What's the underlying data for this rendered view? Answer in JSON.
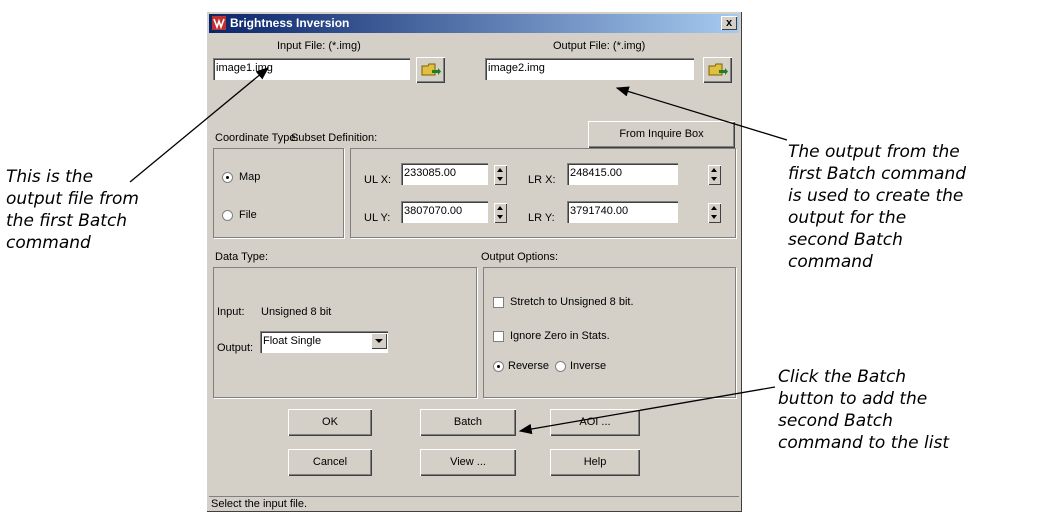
{
  "dialog": {
    "title": "Brightness Inversion",
    "close_label": "x",
    "input_file_label": "Input File: (*.img)",
    "input_file_value": "image1.img",
    "output_file_label": "Output File: (*.img)",
    "output_file_value": "image2.img",
    "coordinate_type_label": "Coordinate Type:",
    "subset_definition_label": "Subset Definition:",
    "from_inquire_box_label": "From Inquire Box",
    "map_label": "Map",
    "file_label": "File",
    "ulx_label": "UL X:",
    "ulx_value": "233085.00",
    "uly_label": "UL Y:",
    "uly_value": "3807070.00",
    "lrx_label": "LR X:",
    "lrx_value": "248415.00",
    "lry_label": "LR Y:",
    "lry_value": "3791740.00",
    "data_type_label": "Data Type:",
    "input_label": "Input:",
    "input_type_value": "Unsigned 8 bit",
    "output_label": "Output:",
    "output_type_value": "Float Single",
    "output_options_label": "Output Options:",
    "stretch_label": "Stretch to Unsigned 8 bit.",
    "ignore_zero_label": "Ignore Zero in Stats.",
    "reverse_label": "Reverse",
    "inverse_label": "Inverse",
    "ok_label": "OK",
    "batch_label": "Batch",
    "aoi_label": "AOI ...",
    "cancel_label": "Cancel",
    "view_label": "View ...",
    "help_label": "Help",
    "status_text": "Select the input file."
  },
  "annotations": {
    "left": "This is the\noutput file from\nthe first Batch\ncommand",
    "right_top": "The output from the\nfirst Batch command\nis used to create the\noutput for the\nsecond Batch\ncommand",
    "right_bottom": "Click the Batch\nbutton to add the\nsecond Batch\ncommand to the list"
  },
  "colors": {
    "dialog_bg": "#d4d0c8",
    "titlebar_start": "#0a246a",
    "titlebar_end": "#a6caf0"
  },
  "state": {
    "coordinate_type": "Map",
    "stretch_checked": false,
    "ignore_zero_checked": false,
    "orientation": "Reverse"
  }
}
